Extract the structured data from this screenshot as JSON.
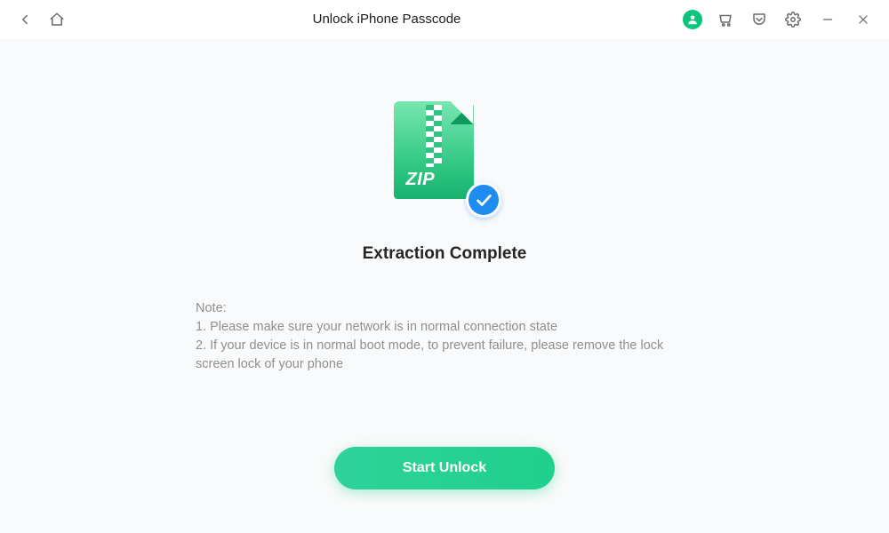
{
  "titlebar": {
    "title": "Unlock iPhone Passcode"
  },
  "main": {
    "zip_label": "ZIP",
    "heading": "Extraction Complete",
    "note_label": "Note:",
    "note_line1": "1. Please make sure your network is in normal connection state",
    "note_line2": "2. If your device is in normal boot mode, to prevent failure, please remove the lock screen lock of your phone",
    "start_button": "Start Unlock"
  }
}
